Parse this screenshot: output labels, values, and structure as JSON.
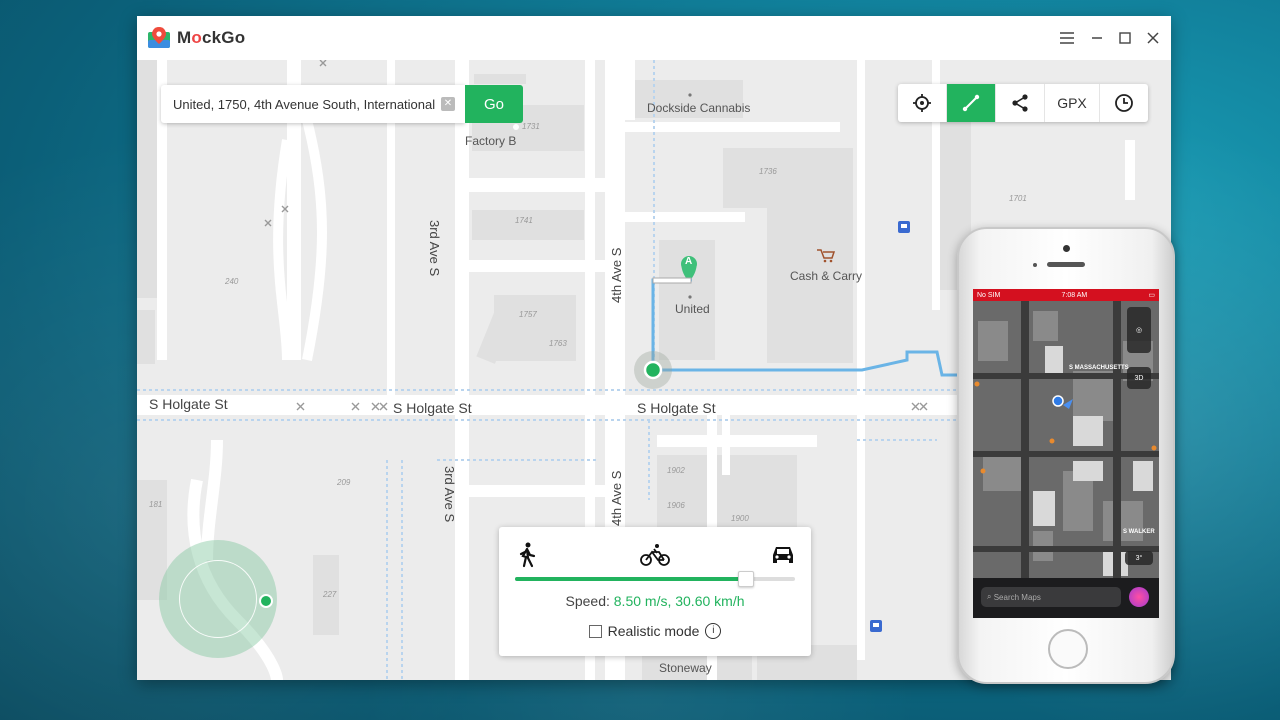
{
  "app": {
    "title_pre": "M",
    "title_o": "o",
    "title_post": "ckGo"
  },
  "window_controls": {
    "menu_icon": "hamburger-menu-icon",
    "minimize_icon": "minimize-icon",
    "maximize_icon": "maximize-icon",
    "close_icon": "close-icon"
  },
  "search": {
    "value": "United, 1750, 4th Avenue South, International",
    "go_label": "Go"
  },
  "toolbar": {
    "teleport_icon": "crosshair-icon",
    "route_icon": "route-icon",
    "share_icon": "share-icon",
    "gpx_label": "GPX",
    "history_icon": "clock-icon"
  },
  "map": {
    "streets": {
      "holgate_left": "S Holgate St",
      "holgate_mid": "S Holgate St",
      "holgate_right": "S Holgate St",
      "third_ave_top": "3rd Ave S",
      "third_ave_bottom": "3rd Ave S",
      "fourth_ave_top": "4th Ave S",
      "fourth_ave_bottom": "4th Ave S"
    },
    "pois": {
      "dockside": "Dockside Cannabis",
      "factory_b": "Factory B",
      "cash_carry": "Cash & Carry",
      "united": "United",
      "stoneway": "Stoneway"
    },
    "numbers": [
      "1731",
      "1736",
      "1701",
      "1741",
      "1757",
      "1763",
      "240",
      "1902",
      "1906",
      "1900",
      "209",
      "181",
      "227"
    ],
    "marker_label": "A"
  },
  "speed_panel": {
    "speed_label": "Speed: ",
    "speed_value": "8.50 m/s, 30.60 km/h",
    "realistic_label": "Realistic mode",
    "slider_fraction": 0.82,
    "modes": [
      "walk-icon",
      "bike-icon",
      "car-icon"
    ]
  },
  "phone": {
    "status_left": "No SIM",
    "status_center": "7:08 AM",
    "status_right": "",
    "search_placeholder": "Search Maps",
    "label_mass": "S MASSACHUSETTS",
    "label_walker": "S WALKER",
    "btn_3d": "3D",
    "temp": "3°"
  },
  "colors": {
    "accent": "#22b35e",
    "route": "#6ab4e6",
    "map_bg": "#ececec",
    "road": "#ffffff",
    "status_red": "#d4101f"
  }
}
